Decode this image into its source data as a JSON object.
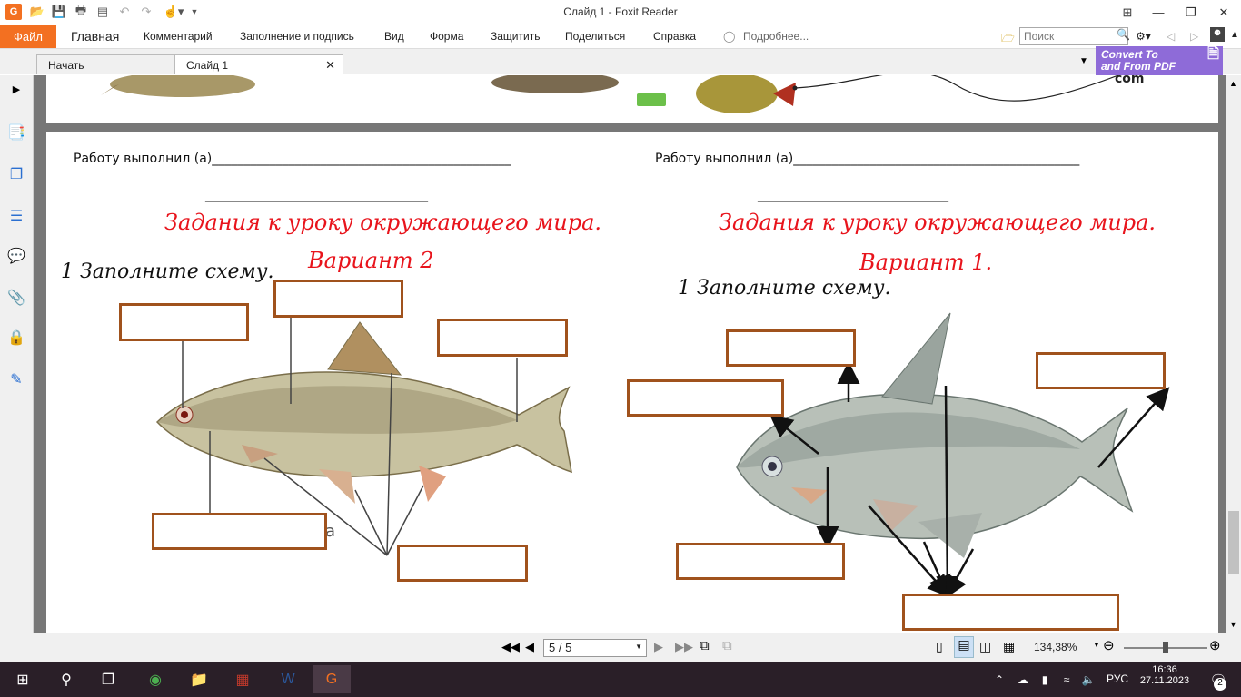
{
  "window": {
    "title": "Слайд 1 - Foxit Reader"
  },
  "menu": {
    "file": "Файл",
    "items": [
      "Главная",
      "Комментарий",
      "Заполнение и подпись",
      "Вид",
      "Форма",
      "Защитить",
      "Поделиться",
      "Справка"
    ],
    "tell_me": "Подробнее...",
    "search_placeholder": "Поиск"
  },
  "tabs": [
    {
      "label": "Начать"
    },
    {
      "label": "Слайд 1"
    }
  ],
  "convert_banner": {
    "line1": "Convert To",
    "line2": "and From PDF"
  },
  "document": {
    "page1_fragment": "com",
    "left": {
      "worker_label": "Работу выполнил (а)_______________________________________________",
      "second_line": "___________________________________",
      "title": "Задания к уроку окружающего мира.",
      "variant": "Вариант 2",
      "task": "1 Заполните схему.",
      "stray_letter": "а"
    },
    "right": {
      "worker_label": "Работу выполнил (а)_____________________________________________",
      "second_line": "______________________________",
      "title": "Задания к уроку окружающего мира.",
      "variant": "Вариант 1.",
      "task": "1 Заполните схему."
    }
  },
  "status": {
    "page": "5 / 5",
    "zoom": "134,38%"
  },
  "taskbar": {
    "lang": "РУС",
    "time": "16:36",
    "date": "27.11.2023",
    "notifications": "2"
  },
  "colors": {
    "accent": "#f37021",
    "handwriting_red": "#e8141c",
    "box_border": "#a0521d",
    "convert_bg": "#8e6bd8",
    "taskbar_bg": "#2a1f28"
  }
}
